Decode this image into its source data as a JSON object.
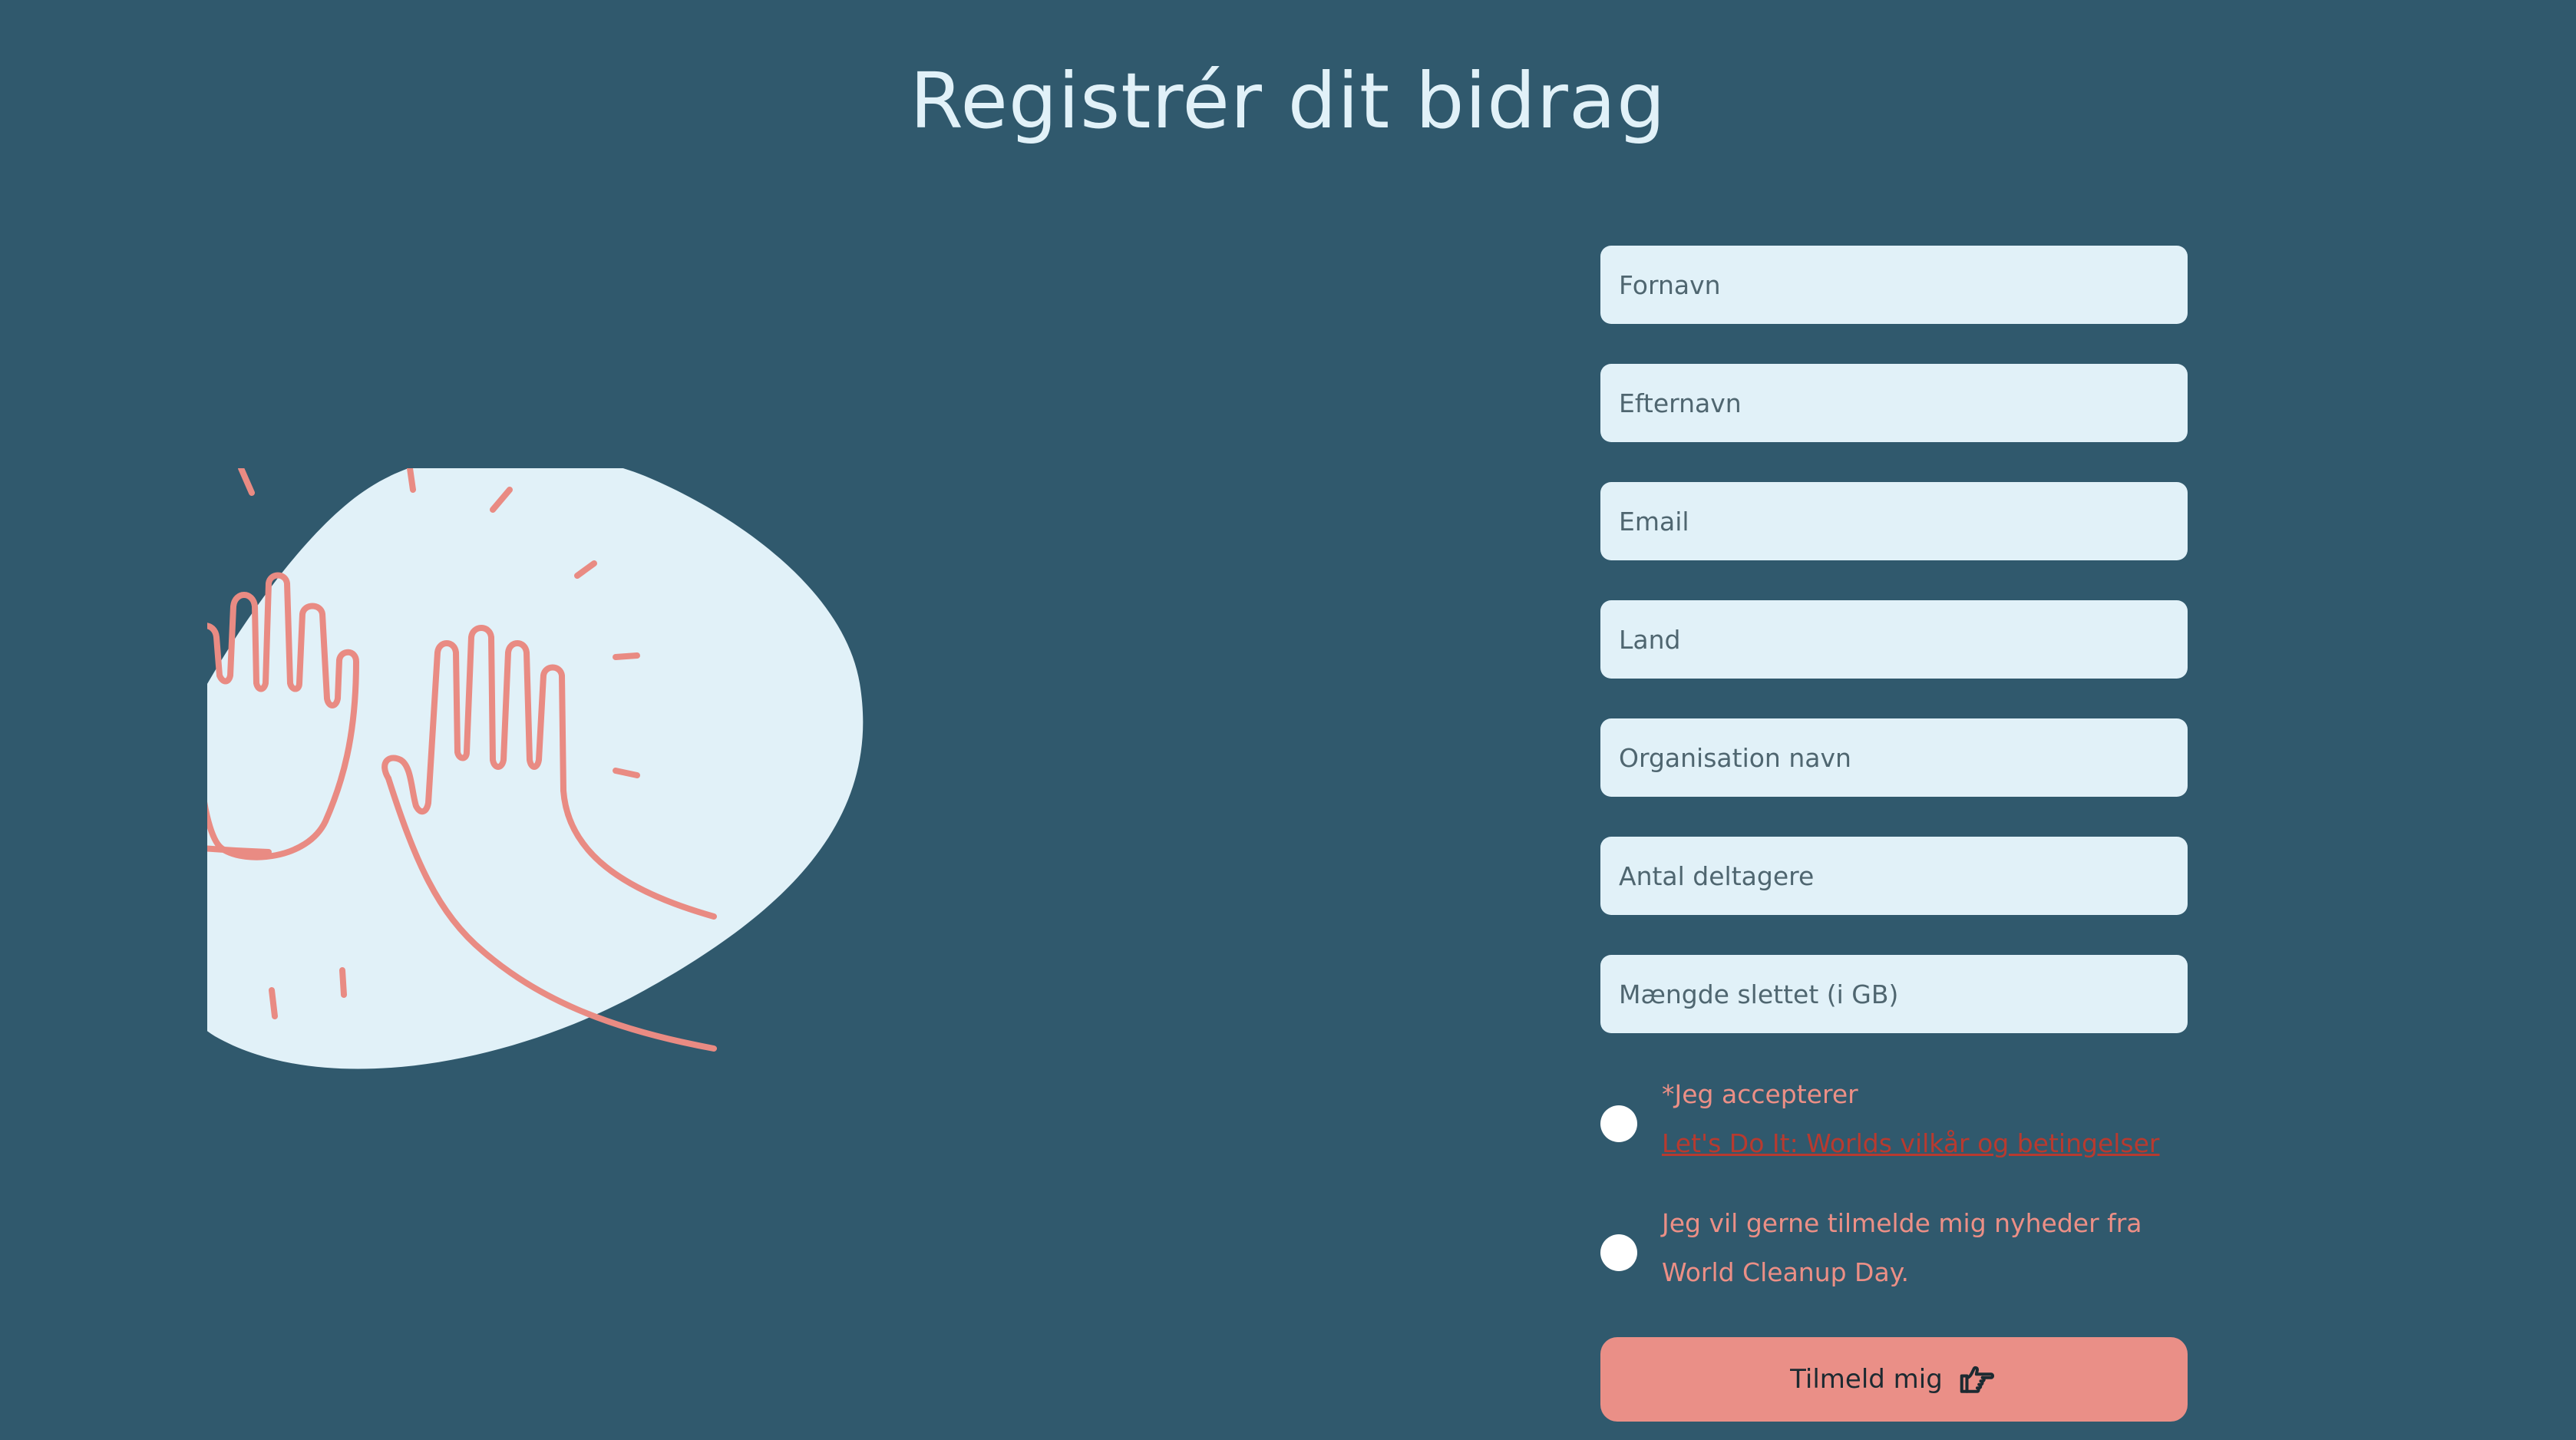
{
  "page": {
    "title": "Registrér dit bidrag"
  },
  "illustration": {
    "icon": "high-five-hands-illustration",
    "blob_color": "#e1f1f8",
    "line_color": "#e98b83"
  },
  "form": {
    "fields": [
      {
        "name": "first-name-field",
        "placeholder": "Fornavn",
        "value": ""
      },
      {
        "name": "last-name-field",
        "placeholder": "Efternavn",
        "value": ""
      },
      {
        "name": "email-field",
        "placeholder": "Email",
        "value": ""
      },
      {
        "name": "country-field",
        "placeholder": "Land",
        "value": ""
      },
      {
        "name": "organisation-name-field",
        "placeholder": "Organisation navn",
        "value": ""
      },
      {
        "name": "participants-count-field",
        "placeholder": "Antal deltagere",
        "value": ""
      },
      {
        "name": "deleted-amount-field",
        "placeholder": "Mængde slettet (i GB)",
        "value": ""
      }
    ],
    "terms": {
      "text": "*Jeg accepterer",
      "link": "Let's Do It: Worlds vilkår og betingelser"
    },
    "newsletter": {
      "text": "Jeg vil gerne tilmelde mig nyheder fra World Cleanup Day."
    },
    "submit": {
      "label": "Tilmeld mig",
      "icon": "pointing-hand-icon"
    }
  },
  "colors": {
    "background": "#30596d",
    "field_background": "#e1f1f8",
    "accent": "#ea8f87",
    "link": "#b83a2f"
  }
}
